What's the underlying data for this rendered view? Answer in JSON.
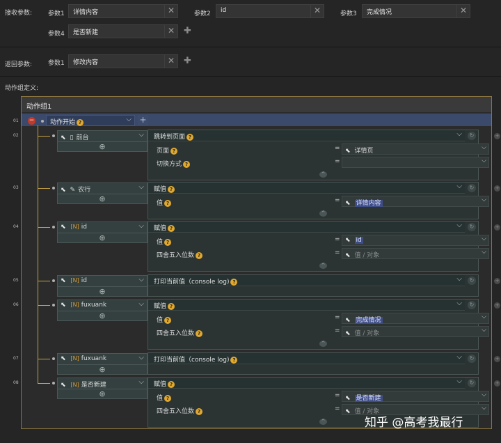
{
  "receive": {
    "label": "接收参数:",
    "params": [
      {
        "name": "参数1",
        "value": "详情内容"
      },
      {
        "name": "参数2",
        "value": "id"
      },
      {
        "name": "参数3",
        "value": "完成情况"
      },
      {
        "name": "参数4",
        "value": "是否新建"
      }
    ]
  },
  "returns": {
    "label": "返回参数:",
    "params": [
      {
        "name": "参数1",
        "value": "修改内容"
      }
    ]
  },
  "group_def_label": "动作组定义:",
  "group": {
    "title": "动作组1",
    "start": {
      "num": "01",
      "label": "动作开始"
    },
    "rows": [
      {
        "num": "02",
        "left": "前台",
        "action": "跳转到页面",
        "props": [
          {
            "name": "页面",
            "value": "详情页"
          },
          {
            "name": "切换方式",
            "value": ""
          }
        ]
      },
      {
        "num": "03",
        "left": "农行",
        "action": "赋值",
        "props": [
          {
            "name": "值",
            "value": "详情内容"
          }
        ]
      },
      {
        "num": "04",
        "left": "id",
        "action": "赋值",
        "props": [
          {
            "name": "值",
            "value": "id"
          },
          {
            "name": "四舍五入位数",
            "value": "值 / 对象"
          }
        ]
      },
      {
        "num": "05",
        "left": "id",
        "action": "打印当前值（console log)"
      },
      {
        "num": "06",
        "left": "fuxuank",
        "action": "赋值",
        "props": [
          {
            "name": "值",
            "value": "完成情况"
          },
          {
            "name": "四舍五入位数",
            "value": "值 / 对象"
          }
        ]
      },
      {
        "num": "07",
        "left": "fuxuank",
        "action": "打印当前值（console log)"
      },
      {
        "num": "08",
        "left": "是否新建",
        "action": "赋值",
        "props": [
          {
            "name": "值",
            "value": "是否新建"
          },
          {
            "name": "四舍五入位数",
            "value": "值 / 对象"
          }
        ]
      }
    ]
  },
  "watermark": "知乎 @高考我最行",
  "icons": {
    "close": "close-icon",
    "add": "plus-icon",
    "help": "question-icon",
    "cursor": "cursor-icon"
  },
  "colors": {
    "group_border": "#8a7440",
    "flow_line": "#c9a445",
    "help_badge": "#e0a82e",
    "highlight": "#3f4d86"
  }
}
